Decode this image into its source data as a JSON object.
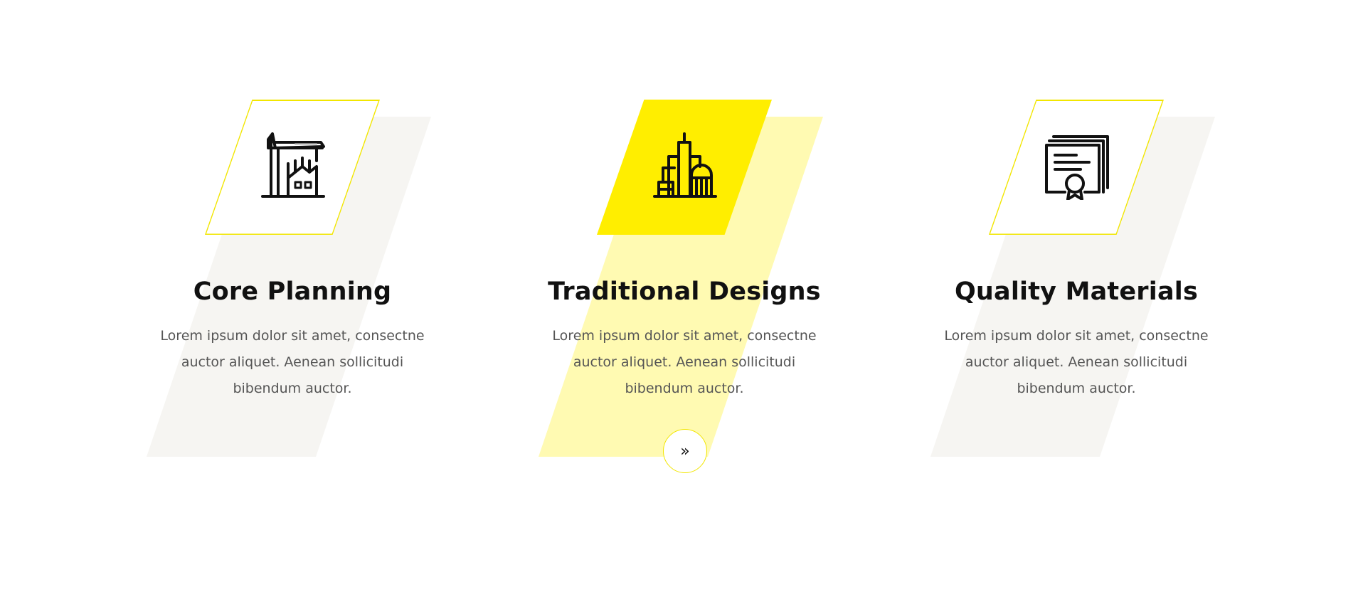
{
  "features": [
    {
      "title": "Core Planning",
      "text": "Lorem ipsum dolor sit amet, consectne auctor aliquet. Aenean sollicitudi bibendum auctor.",
      "icon": "crane-construction-icon"
    },
    {
      "title": "Traditional Designs",
      "text": "Lorem ipsum dolor sit amet, consectne auctor aliquet. Aenean sollicitudi bibendum auctor.",
      "icon": "city-buildings-icon",
      "button_glyph": "»"
    },
    {
      "title": "Quality Materials",
      "text": "Lorem ipsum dolor sit amet, consectne auctor aliquet. Aenean sollicitudi bibendum auctor.",
      "icon": "certificate-icon"
    }
  ],
  "colors": {
    "accent": "#ffee00",
    "accent_light": "#fffab2",
    "shadow": "#f6f5f2",
    "title": "#111111",
    "text": "#555555"
  }
}
